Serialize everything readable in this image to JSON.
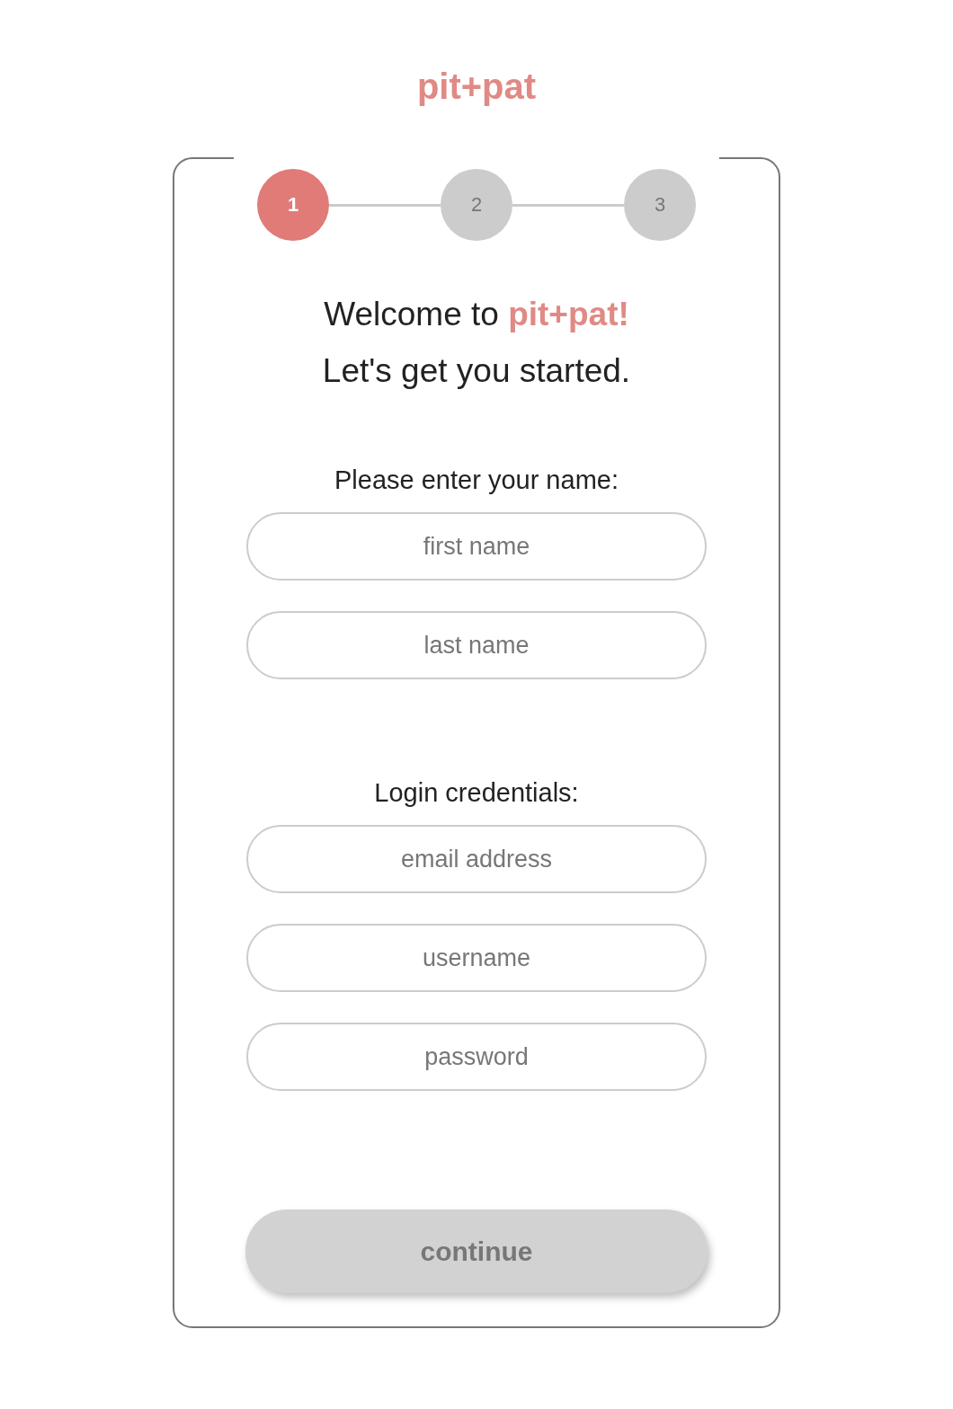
{
  "logo": "pit+pat",
  "steps": [
    {
      "label": "1",
      "selected": true
    },
    {
      "label": "2",
      "selected": false
    },
    {
      "label": "3",
      "selected": false
    }
  ],
  "heading": [
    "Welcome to **pit+pat!**",
    "Let's get you started."
  ],
  "sections": [
    {
      "label": "Please enter your name:",
      "fields": [
        {
          "placeholder": "first name"
        },
        {
          "placeholder": "last name"
        }
      ]
    },
    {
      "label": "Login credentials:",
      "fields": [
        {
          "placeholder": "email address"
        },
        {
          "placeholder": "username"
        },
        {
          "placeholder": "password"
        }
      ]
    }
  ],
  "button": {
    "label": "continue",
    "disabled": true
  }
}
